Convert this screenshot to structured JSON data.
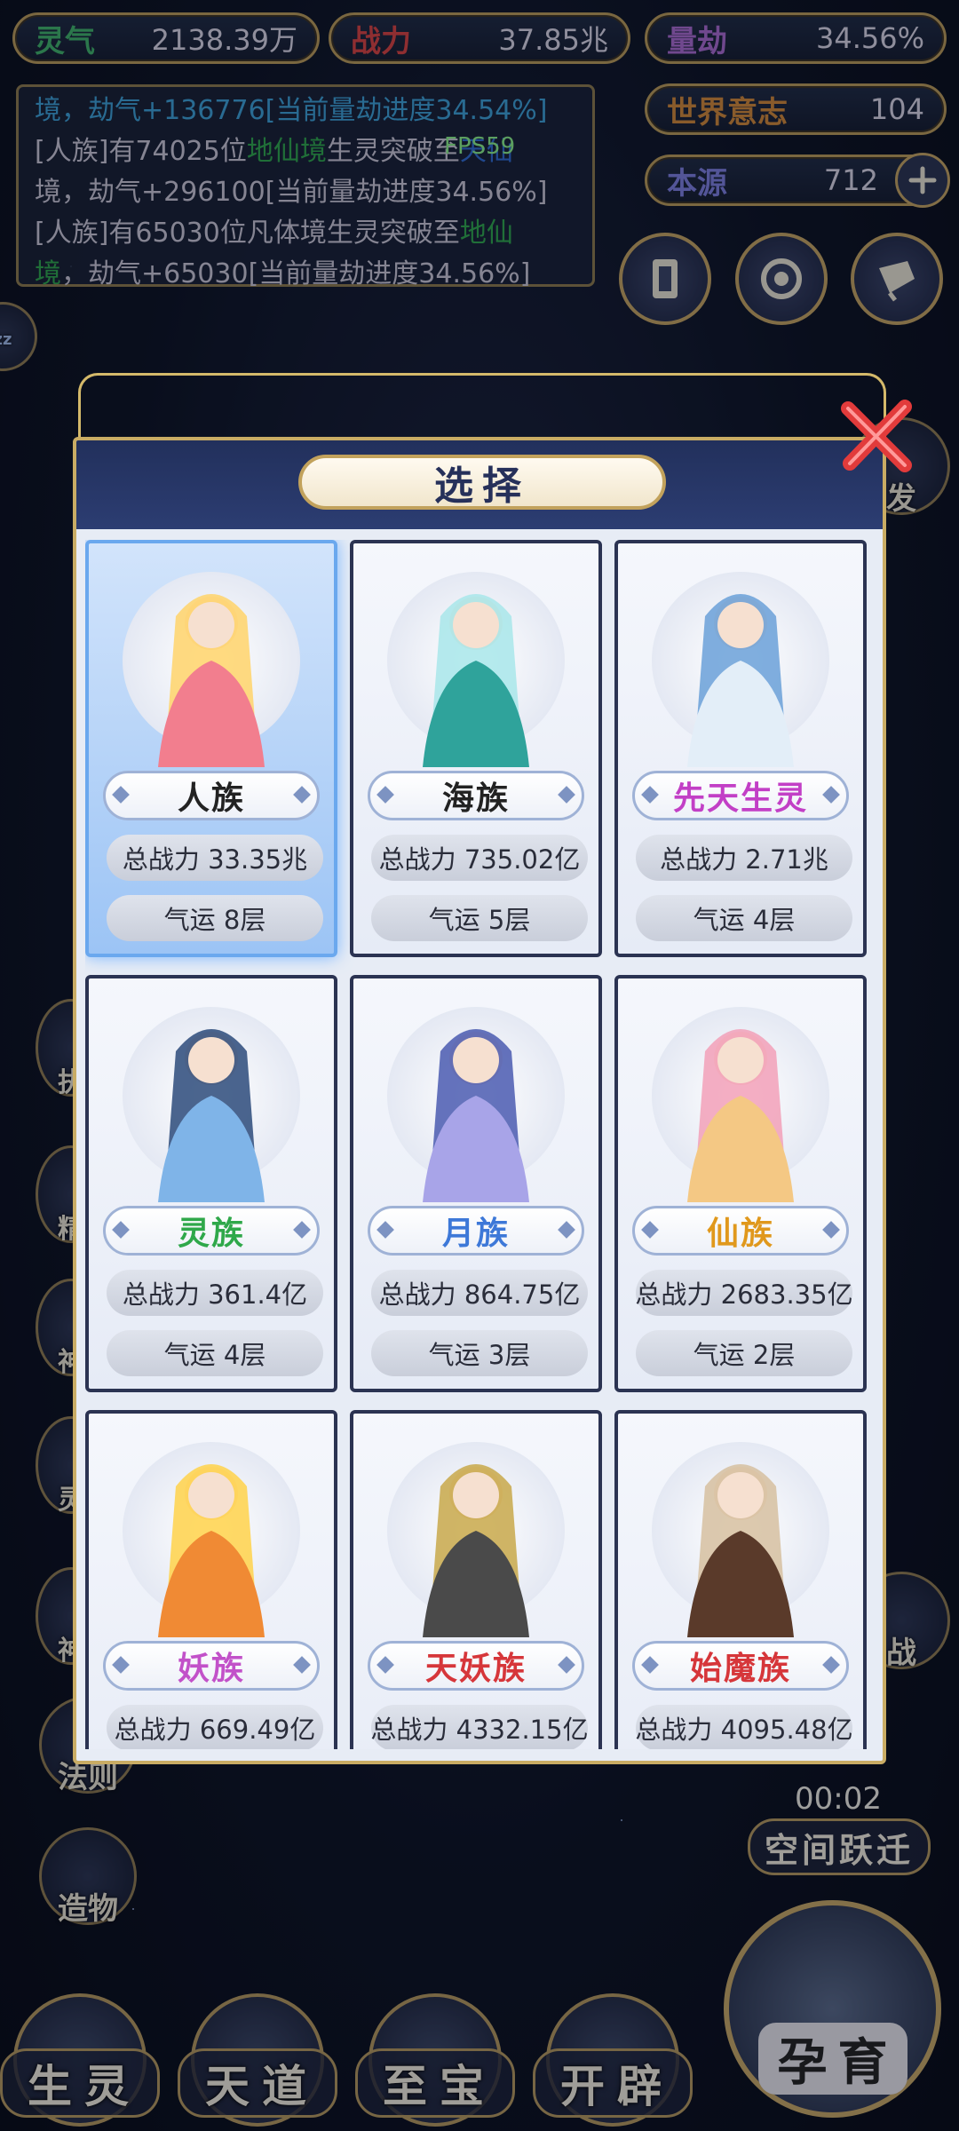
{
  "resources": {
    "lingqi": {
      "label": "灵气",
      "value": "2138.39万"
    },
    "zhanli": {
      "label": "战力",
      "value": "37.85兆"
    },
    "liangjie": {
      "label": "量劫",
      "value": "34.56%"
    },
    "shijie": {
      "label": "世界意志",
      "value": "104"
    },
    "benyuan": {
      "label": "本源",
      "value": "712"
    }
  },
  "fps": "FPS59",
  "log": {
    "line1": "境，劫气+136776[当前量劫进度34.54%]",
    "line2a": "[人族]有74025位",
    "line2b": "地仙境",
    "line2c": "生灵突破至",
    "line2d": "天仙",
    "line3": "境，劫气+296100[当前量劫进度34.56%]",
    "line4a": "[人族]有65030位凡体境生灵突破至",
    "line4b": "地仙",
    "line5a": "境",
    "line5b": "，劫气+65030[当前量劫进度34.56%]"
  },
  "modal": {
    "title": "选择",
    "cards": [
      {
        "name": "人族",
        "name_color": "#222222",
        "power": "总战力 33.35兆",
        "luck": "气运 8层",
        "selected": true
      },
      {
        "name": "海族",
        "name_color": "#222222",
        "power": "总战力 735.02亿",
        "luck": "气运 5层",
        "selected": false
      },
      {
        "name": "先天生灵",
        "name_color": "#c23fc6",
        "power": "总战力 2.71兆",
        "luck": "气运 4层",
        "selected": false
      },
      {
        "name": "灵族",
        "name_color": "#2fa84a",
        "power": "总战力 361.4亿",
        "luck": "气运 4层",
        "selected": false
      },
      {
        "name": "月族",
        "name_color": "#3d78d8",
        "power": "总战力 864.75亿",
        "luck": "气运 3层",
        "selected": false
      },
      {
        "name": "仙族",
        "name_color": "#e0981c",
        "power": "总战力 2683.35亿",
        "luck": "气运 2层",
        "selected": false
      },
      {
        "name": "妖族",
        "name_color": "#c251c9",
        "power": "总战力 669.49亿",
        "luck": "",
        "selected": false
      },
      {
        "name": "天妖族",
        "name_color": "#d6363a",
        "power": "总战力 4332.15亿",
        "luck": "",
        "selected": false
      },
      {
        "name": "始魔族",
        "name_color": "#d6363a",
        "power": "总战力 4095.48亿",
        "luck": "",
        "selected": false
      }
    ]
  },
  "side_buttons": [
    {
      "label": "法则"
    },
    {
      "label": "造物"
    }
  ],
  "side_partial_right": [
    "发",
    "战"
  ],
  "side_partial_left": [
    "执",
    "精",
    "神",
    "灵",
    "神"
  ],
  "timer": "00:02",
  "space_jump": "空间跃迁",
  "bottom_nav": [
    {
      "label": "生灵"
    },
    {
      "label": "天道"
    },
    {
      "label": "至宝"
    },
    {
      "label": "开辟"
    }
  ],
  "big_button": "孕育",
  "colors": {
    "accent_gold": "#c9ac64",
    "panel": "#e7ecf5",
    "selected": "#6aa8ee"
  }
}
